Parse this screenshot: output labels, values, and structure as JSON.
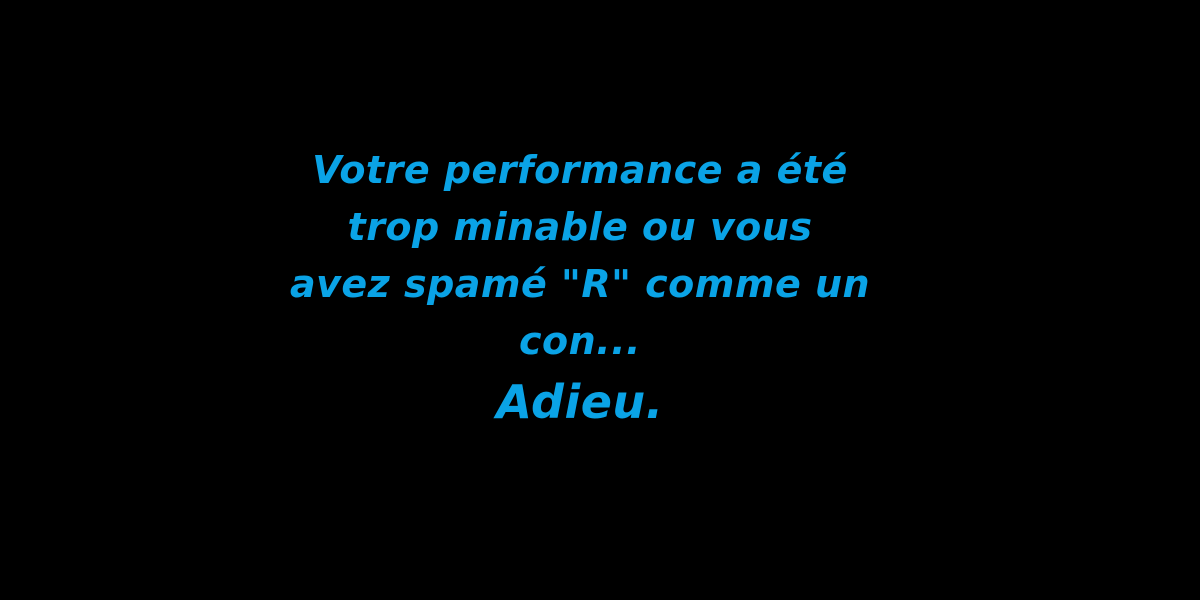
{
  "game_over": {
    "message_lines": [
      "Votre performance a été",
      "trop minable ou vous",
      "avez spamé \"R\" comme un",
      "con..."
    ],
    "farewell": "Adieu."
  },
  "colors": {
    "background": "#000000",
    "text": "#0aa3e6"
  }
}
